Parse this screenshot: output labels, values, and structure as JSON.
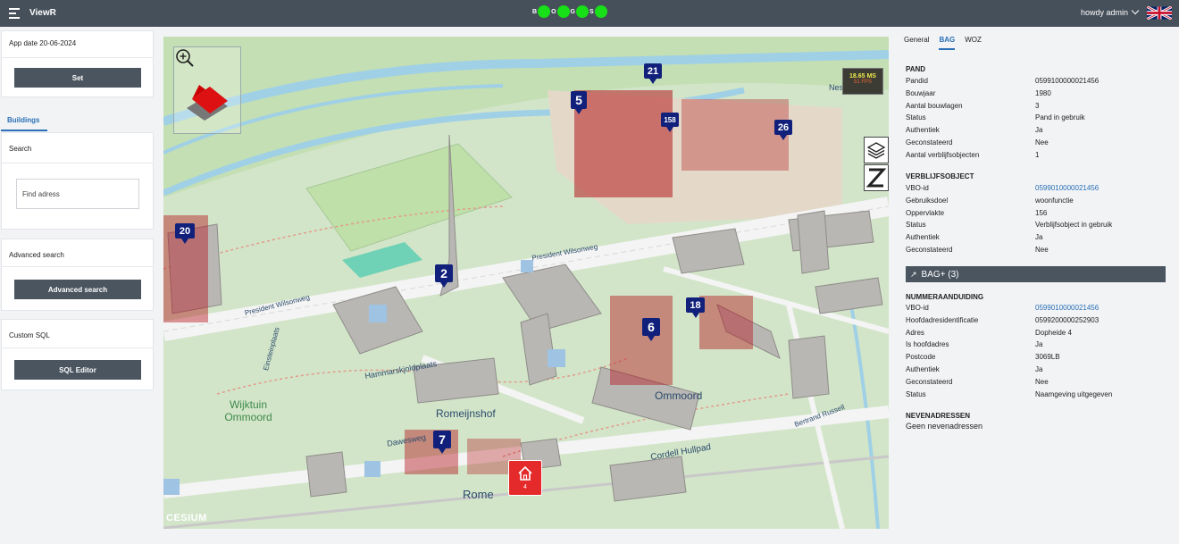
{
  "topbar": {
    "title": "ViewR",
    "status": [
      {
        "letter": "B",
        "color": "#18e018"
      },
      {
        "letter": "O",
        "color": "#18e018"
      },
      {
        "letter": "G",
        "color": "#18e018"
      },
      {
        "letter": "S",
        "color": "#18e018"
      }
    ],
    "user": "howdy admin"
  },
  "left": {
    "app_date": "App date 20-06-2024",
    "set_label": "Set",
    "tab_label": "Buildings",
    "search_label": "Search",
    "search_placeholder": "Find adress",
    "advanced_label": "Advanced search",
    "advanced_button": "Advanced search",
    "custom_sql_label": "Custom SQL",
    "sql_button": "SQL Editor"
  },
  "map": {
    "fps_ms": "18.65 MS",
    "fps": "51 FPS",
    "markers": [
      {
        "label": "21"
      },
      {
        "label": "5"
      },
      {
        "label": "158"
      },
      {
        "label": "26"
      },
      {
        "label": "20"
      },
      {
        "label": "2"
      },
      {
        "label": "18"
      },
      {
        "label": "6"
      },
      {
        "label": "7"
      }
    ],
    "home_count": "4",
    "streets": [
      "President Wilsonweg",
      "President Wilsonweg",
      "Hammarskjoldplaats",
      "Romeijnshof",
      "Dawesweg",
      "Cordell Hullpad",
      "Bertrand Russell",
      "Einsteinplaats",
      "Wijktuin Ommoord",
      "Ommoord",
      "Rome",
      "Ness"
    ],
    "attribution": "CESIUM"
  },
  "right": {
    "tabs": [
      "General",
      "BAG",
      "WOZ"
    ],
    "active_tab": "BAG",
    "pand": {
      "title": "PAND",
      "rows": [
        {
          "k": "Pandid",
          "v": "0599100000021456"
        },
        {
          "k": "Bouwjaar",
          "v": "1980"
        },
        {
          "k": "Aantal bouwlagen",
          "v": "3"
        },
        {
          "k": "Status",
          "v": "Pand in gebruik"
        },
        {
          "k": "Authentiek",
          "v": "Ja"
        },
        {
          "k": "Geconstateerd",
          "v": "Nee"
        },
        {
          "k": "Aantal verblijfsobjecten",
          "v": "1"
        }
      ]
    },
    "vbo": {
      "title": "VERBLIJFSOBJECT",
      "rows": [
        {
          "k": "VBO-id",
          "v": "0599010000021456",
          "link": true
        },
        {
          "k": "Gebruiksdoel",
          "v": "woonfunctie"
        },
        {
          "k": "Oppervlakte",
          "v": "156"
        },
        {
          "k": "Status",
          "v": "Verblijfsobject in gebruik"
        },
        {
          "k": "Authentiek",
          "v": "Ja"
        },
        {
          "k": "Geconstateerd",
          "v": "Nee"
        }
      ]
    },
    "bagplus": "BAG+ (3)",
    "nummeraanduiding": {
      "title": "NUMMERAANDUIDING",
      "rows": [
        {
          "k": "VBO-id",
          "v": "0599010000021456",
          "link": true
        },
        {
          "k": "Hoofdadresidentificatie",
          "v": "0599200000252903"
        },
        {
          "k": "Adres",
          "v": "Dopheide 4"
        },
        {
          "k": "Is hoofdadres",
          "v": "Ja"
        },
        {
          "k": "Postcode",
          "v": "3069LB"
        },
        {
          "k": "Authentiek",
          "v": "Ja"
        },
        {
          "k": "Geconstateerd",
          "v": "Nee"
        },
        {
          "k": "Status",
          "v": "Naamgeving uitgegeven"
        }
      ]
    },
    "nevenadressen": {
      "title": "NEVENADRESSEN",
      "value": "Geen nevenadressen"
    }
  }
}
